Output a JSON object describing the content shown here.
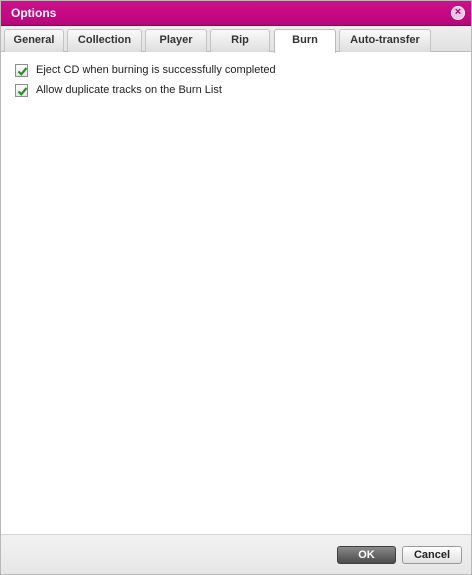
{
  "window": {
    "title": "Options"
  },
  "tabs": [
    {
      "label": "General"
    },
    {
      "label": "Collection"
    },
    {
      "label": "Player"
    },
    {
      "label": "Rip"
    },
    {
      "label": "Burn",
      "active": true
    },
    {
      "label": "Auto-transfer"
    }
  ],
  "burn": {
    "options": [
      {
        "label": "Eject CD when burning is successfully completed",
        "checked": true
      },
      {
        "label": "Allow duplicate tracks on the Burn List",
        "checked": true
      }
    ]
  },
  "buttons": {
    "ok": "OK",
    "cancel": "Cancel"
  },
  "colors": {
    "accent": "#c40a84",
    "check": "#2e8b2e"
  }
}
